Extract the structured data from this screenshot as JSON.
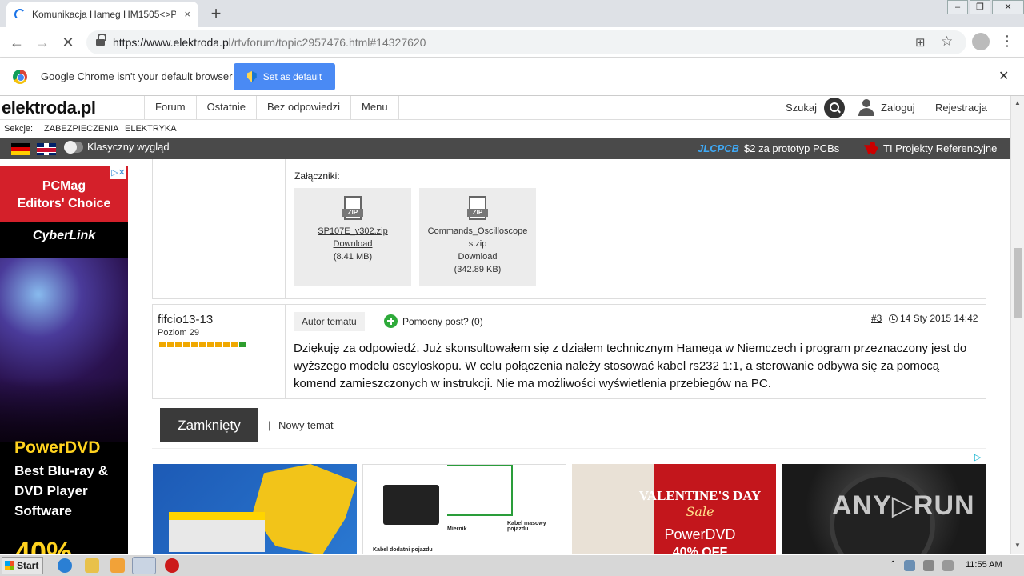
{
  "browser": {
    "tab_title": "Komunikacja Hameg HM1505<>PC - ",
    "tab_close": "×",
    "new_tab": "+",
    "url_host": "https://www.elektroda.pl",
    "url_path": "/rtvforum/topic2957476.html#14327620",
    "nav": {
      "back": "←",
      "forward": "→",
      "stop": "✕"
    },
    "translate_icon": "translate-icon",
    "star": "☆",
    "menu": "⋮",
    "window_controls": [
      "–",
      "❐",
      "✕"
    ]
  },
  "infobar": {
    "message": "Google Chrome isn't your default browser",
    "button_label": "Set as default",
    "close": "✕"
  },
  "site": {
    "logo": "elektroda.pl",
    "nav": [
      "Forum",
      "Ostatnie",
      "Bez odpowiedzi",
      "Menu"
    ],
    "search_label": "Szukaj",
    "login": "Zaloguj",
    "register": "Rejestracja",
    "sections_label": "Sekcje:",
    "sections": [
      "ZABEZPIECZENIA",
      "ELEKTRYKA"
    ],
    "classic_view": "Klasyczny wygląd",
    "jlc_brand": "JLCPCB",
    "jlc_text": "$2 za prototyp PCBs",
    "ti_text": "TI Projekty Referencyjne"
  },
  "left_ad": {
    "close": "▷✕",
    "pcmag": "PCMag",
    "editors": "Editors' Choice",
    "brand": "CyberLink",
    "product": "PowerDVD",
    "blurb": "Best Blu-ray & DVD Player Software",
    "discount": "40%"
  },
  "attachments": {
    "label": "Załączniki:",
    "files": [
      {
        "name": "SP107E_v302.zip",
        "action": "Download",
        "size": "(8.41 MB)"
      },
      {
        "name": "Commands_Oscilloscopes.zip",
        "action": "Download",
        "size": "(342.89 KB)"
      }
    ]
  },
  "post": {
    "username": "fifcio13-13",
    "level": "Poziom 29",
    "level_filled": 10,
    "level_total": 11,
    "author_badge": "Autor tematu",
    "helpful": "Pomocny post? (0)",
    "post_number": "#3",
    "date": "14 Sty 2015 14:42",
    "body": "Dziękuję za odpowiedź. Już skonsultowałem się z działem technicznym Hamega w Niemczech i program przeznaczony jest do wyższego modelu oscyloskopu. W celu połączenia należy stosować kabel rs232 1:1, a sterowanie odbywa się za pomocą komend zamieszczonych w instrukcji. Nie ma możliwości wyświetlenia przebiegów na PC."
  },
  "actions": {
    "closed": "Zamknięty",
    "separator": "|",
    "new_topic": "Nowy temat"
  },
  "bottom_ads": {
    "adchoice": "▷",
    "tile2_labels": [
      "Kabel dodatni pojazdu",
      "Miernik",
      "Kabel masowy pojazdu"
    ],
    "tile3_title": "VALENTINE'S DAY",
    "tile3_sale": "Sale",
    "tile3_product": "PowerDVD",
    "tile3_off": "40% OFF",
    "watermark": "ANY▷RUN"
  },
  "taskbar": {
    "start": "Start",
    "clock": "11:55 AM"
  }
}
